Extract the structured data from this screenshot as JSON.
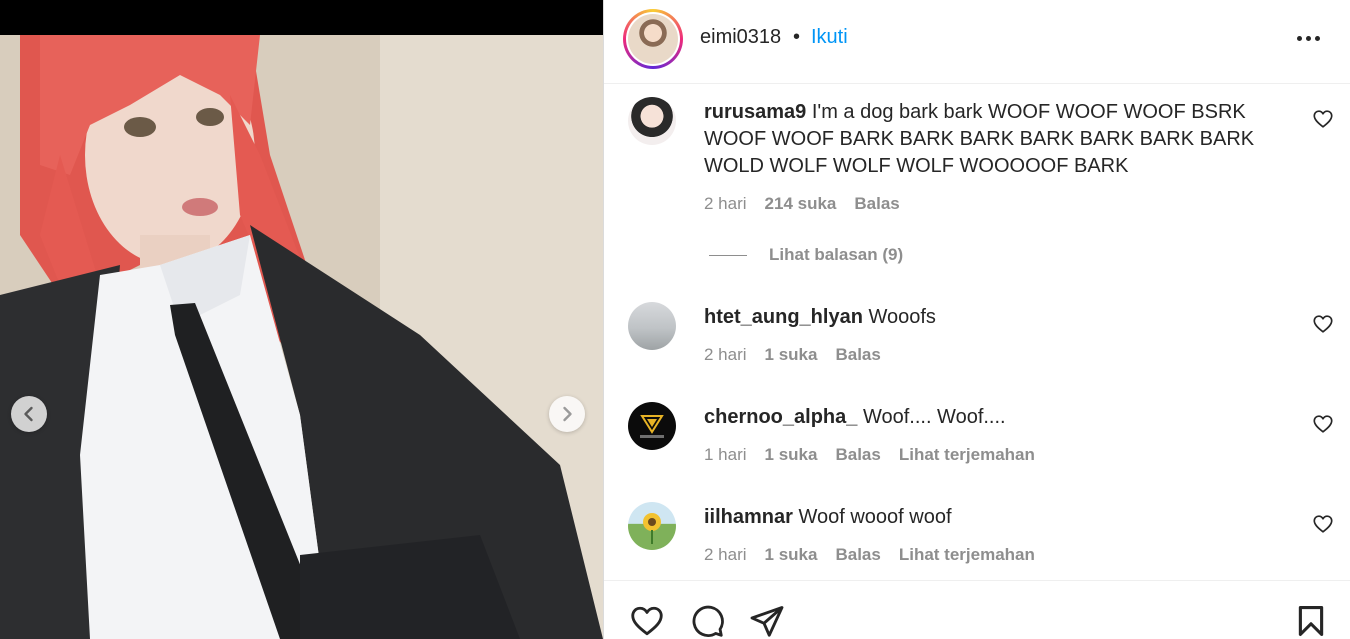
{
  "post": {
    "username": "eimi0318",
    "separator": "•",
    "follow_label": "Ikuti",
    "more_icon": "more-horizontal-icon"
  },
  "media": {
    "prev_icon": "chevron-left-icon",
    "next_icon": "chevron-right-icon"
  },
  "comments": [
    {
      "username": "rurusama9",
      "text": "I'm a dog bark bark WOOF WOOF WOOF BSRK WOOF WOOF BARK BARK BARK BARK BARK BARK BARK WOLD WOLF WOLF WOLF WOOOOOF BARK",
      "time": "2 hari",
      "likes": "214 suka",
      "reply": "Balas",
      "translate": "",
      "view_replies": "Lihat balasan (9)"
    },
    {
      "username": "htet_aung_hlyan",
      "text": "Wooofs",
      "time": "2 hari",
      "likes": "1 suka",
      "reply": "Balas",
      "translate": ""
    },
    {
      "username": "chernoo_alpha_",
      "text": "Woof.... Woof....",
      "time": "1 hari",
      "likes": "1 suka",
      "reply": "Balas",
      "translate": "Lihat terjemahan"
    },
    {
      "username": "iilhamnar",
      "text": "Woof wooof woof",
      "time": "2 hari",
      "likes": "1 suka",
      "reply": "Balas",
      "translate": "Lihat terjemahan"
    }
  ],
  "actions": {
    "like_icon": "heart-icon",
    "comment_icon": "comment-icon",
    "share_icon": "send-icon",
    "save_icon": "bookmark-icon"
  },
  "colors": {
    "accent": "#0095f6",
    "text": "#262626",
    "secondary": "#8e8e8e",
    "border": "#dbdbdb"
  }
}
